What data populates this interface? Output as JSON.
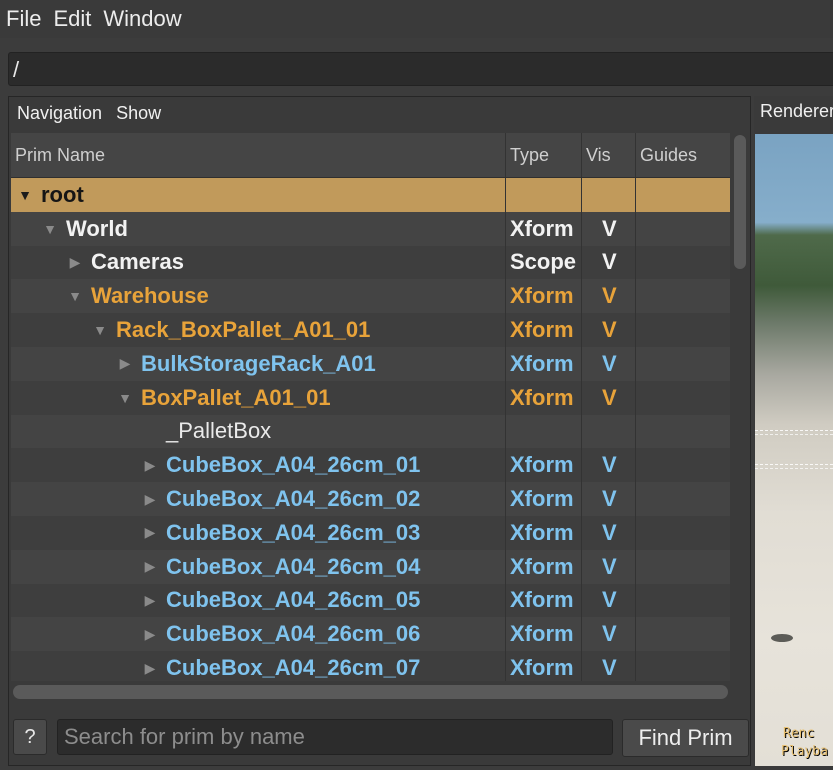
{
  "menu": [
    "File",
    "Edit",
    "Window"
  ],
  "path": "/",
  "nav_tabs": [
    "Navigation",
    "Show"
  ],
  "columns": {
    "name": "Prim Name",
    "type": "Type",
    "vis": "Vis",
    "guides": "Guides"
  },
  "rows": [
    {
      "name": "root",
      "type": "",
      "vis": "",
      "arrow": "down",
      "indent": 0,
      "style": "normal",
      "selected": true
    },
    {
      "name": "World",
      "type": "Xform",
      "vis": "V",
      "arrow": "down",
      "indent": 1,
      "style": "normal"
    },
    {
      "name": "Cameras",
      "type": "Scope",
      "vis": "V",
      "arrow": "right",
      "indent": 2,
      "style": "normal"
    },
    {
      "name": "Warehouse",
      "type": "Xform",
      "vis": "V",
      "arrow": "down",
      "indent": 2,
      "style": "orange"
    },
    {
      "name": "Rack_BoxPallet_A01_01",
      "type": "Xform",
      "vis": "V",
      "arrow": "down",
      "indent": 3,
      "style": "orange"
    },
    {
      "name": "BulkStorageRack_A01",
      "type": "Xform",
      "vis": "V",
      "arrow": "right",
      "indent": 4,
      "style": "blue"
    },
    {
      "name": "BoxPallet_A01_01",
      "type": "Xform",
      "vis": "V",
      "arrow": "down",
      "indent": 4,
      "style": "orange"
    },
    {
      "name": "_PalletBox",
      "type": "",
      "vis": "",
      "arrow": "none",
      "indent": 5,
      "style": "plain"
    },
    {
      "name": "CubeBox_A04_26cm_01",
      "type": "Xform",
      "vis": "V",
      "arrow": "right",
      "indent": 5,
      "style": "blue"
    },
    {
      "name": "CubeBox_A04_26cm_02",
      "type": "Xform",
      "vis": "V",
      "arrow": "right",
      "indent": 5,
      "style": "blue"
    },
    {
      "name": "CubeBox_A04_26cm_03",
      "type": "Xform",
      "vis": "V",
      "arrow": "right",
      "indent": 5,
      "style": "blue"
    },
    {
      "name": "CubeBox_A04_26cm_04",
      "type": "Xform",
      "vis": "V",
      "arrow": "right",
      "indent": 5,
      "style": "blue"
    },
    {
      "name": "CubeBox_A04_26cm_05",
      "type": "Xform",
      "vis": "V",
      "arrow": "right",
      "indent": 5,
      "style": "blue"
    },
    {
      "name": "CubeBox_A04_26cm_06",
      "type": "Xform",
      "vis": "V",
      "arrow": "right",
      "indent": 5,
      "style": "blue"
    },
    {
      "name": "CubeBox_A04_26cm_07",
      "type": "Xform",
      "vis": "V",
      "arrow": "right",
      "indent": 5,
      "style": "blue"
    }
  ],
  "help_button": "?",
  "search": {
    "placeholder": "Search for prim by name",
    "value": ""
  },
  "find_button": "Find Prim",
  "viewport": {
    "tab": "Renderer",
    "overlay_lines": [
      "Renc",
      "Playba"
    ]
  },
  "colors": {
    "selected_row": "#c19a5b",
    "orange": "#e8a33a",
    "blue": "#7fc3ee"
  }
}
